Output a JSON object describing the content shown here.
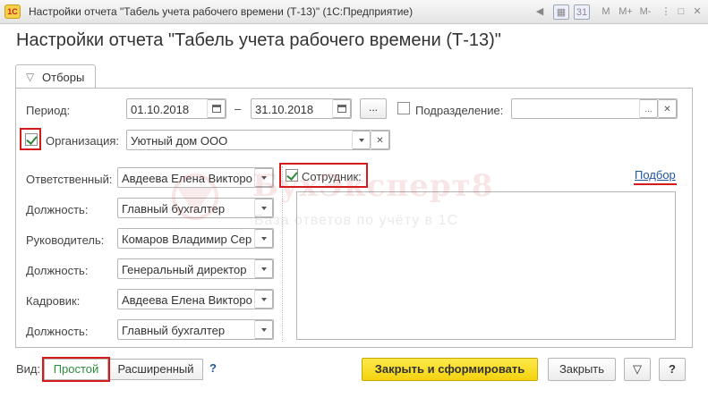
{
  "window": {
    "title": "Настройки отчета \"Табель учета рабочего времени (Т-13)\"  (1С:Предприятие)",
    "app_icon": "1С",
    "toolbar_icons": [
      "M",
      "M+",
      "M-"
    ]
  },
  "heading": "Настройки отчета \"Табель учета рабочего времени (Т-13)\"",
  "tab": {
    "label": "Отборы"
  },
  "period": {
    "label": "Период:",
    "from": "01.10.2018",
    "dash": "–",
    "to": "31.10.2018",
    "dots": "..."
  },
  "subdivision": {
    "label": "Подразделение:",
    "value": "",
    "dots": "...",
    "checked": false
  },
  "organization": {
    "label": "Организация:",
    "value": "Уютный дом ООО",
    "checked": true
  },
  "signers": [
    {
      "label": "Ответственный:",
      "value": "Авдеева Елена Викторо"
    },
    {
      "label": "Должность:",
      "value": "Главный бухгалтер"
    },
    {
      "label": "Руководитель:",
      "value": "Комаров Владимир Сер"
    },
    {
      "label": "Должность:",
      "value": "Генеральный директор"
    },
    {
      "label": "Кадровик:",
      "value": "Авдеева Елена Викторо"
    },
    {
      "label": "Должность:",
      "value": "Главный бухгалтер"
    }
  ],
  "employee": {
    "label": "Сотрудник:",
    "checked": true,
    "pick_link": "Подбор"
  },
  "watermark": {
    "title": "БухЭксперт8",
    "subtitle": "База ответов по учёту в 1С"
  },
  "footer": {
    "view_label": "Вид:",
    "simple": "Простой",
    "extended": "Расширенный",
    "help": "?",
    "close_and_build": "Закрыть и сформировать",
    "close": "Закрыть",
    "help_button": "?"
  },
  "colors": {
    "accent_red": "#d51a1a",
    "primary_yellow": "#f3d20e",
    "check_green": "#2d8a3a",
    "link_blue": "#2357a3"
  }
}
